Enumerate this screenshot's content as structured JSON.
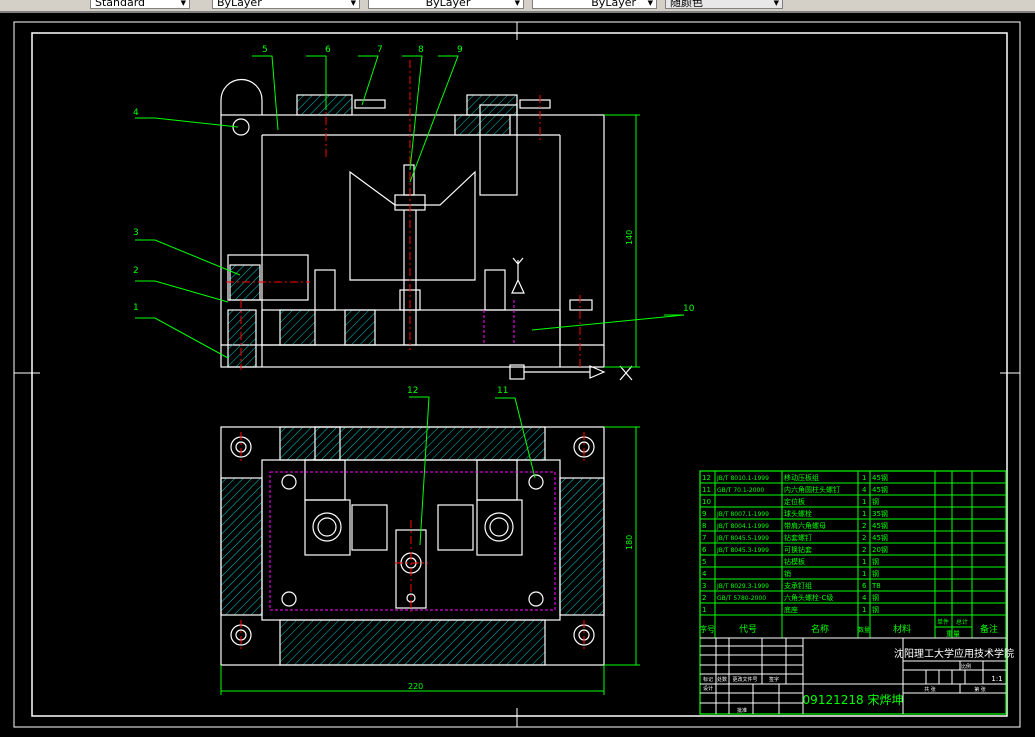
{
  "toolbar": {
    "text_style": "Standard",
    "layer": "ByLayer",
    "linetype": "ByLayer",
    "lineweight": "ByLayer",
    "color": "随颜色"
  },
  "colors": {
    "background": "#000000",
    "lines": "#ffffff",
    "annotation": "#00ff00",
    "centerline": "#ff0000",
    "hatch": "#00ffff"
  },
  "drawing": {
    "balloons": [
      "1",
      "2",
      "3",
      "4",
      "5",
      "6",
      "7",
      "8",
      "9",
      "10",
      "11",
      "12"
    ],
    "dimensions": {
      "height_front": "140",
      "height_top": "180",
      "width_top": "220"
    },
    "axis_labels": {
      "x": "X",
      "y": "Y"
    }
  },
  "parts_list": {
    "headers": {
      "no": "序号",
      "code": "代号",
      "name": "名称",
      "qty": "数量",
      "material": "材料",
      "unit": "单件",
      "total": "总计",
      "weight": "重量",
      "remark": "备注"
    },
    "rows": [
      {
        "no": "12",
        "code": "JB/T 8010.1-1999",
        "name": "移动压板组",
        "qty": "1",
        "material": "45钢"
      },
      {
        "no": "11",
        "code": "GB/T 70.1-2000",
        "name": "内六角圆柱头螺钉",
        "qty": "4",
        "material": "45钢"
      },
      {
        "no": "10",
        "code": "",
        "name": "定位板",
        "qty": "1",
        "material": "钢"
      },
      {
        "no": "9",
        "code": "JB/T 8007.1-1999",
        "name": "球头螺栓",
        "qty": "1",
        "material": "35钢"
      },
      {
        "no": "8",
        "code": "JB/T 8004.1-1999",
        "name": "带肩六角螺母",
        "qty": "2",
        "material": "45钢"
      },
      {
        "no": "7",
        "code": "JB/T 8045.5-1999",
        "name": "钻套螺钉",
        "qty": "2",
        "material": "45钢"
      },
      {
        "no": "6",
        "code": "JB/T 8045.3-1999",
        "name": "可换钻套",
        "qty": "2",
        "material": "20钢"
      },
      {
        "no": "5",
        "code": "",
        "name": "钻模板",
        "qty": "1",
        "material": "钢"
      },
      {
        "no": "4",
        "code": "",
        "name": "销",
        "qty": "1",
        "material": "钢"
      },
      {
        "no": "3",
        "code": "JB/T 8029.3-1999",
        "name": "支承钉组",
        "qty": "6",
        "material": "T8"
      },
      {
        "no": "2",
        "code": "GB/T 5780-2000",
        "name": "六角头螺栓-C级",
        "qty": "4",
        "material": "钢"
      },
      {
        "no": "1",
        "code": "",
        "name": "底座",
        "qty": "1",
        "material": "钢"
      }
    ]
  },
  "title_block": {
    "school": "沈阳理工大学应用技术学院",
    "student": "09121218 宋烨坤",
    "scale": "1:1",
    "labels": {
      "mark": "标记",
      "count": "处数",
      "doc": "更改文件号",
      "sign": "签字",
      "design": "设计",
      "approve": "批准",
      "review": "审核",
      "sheet": "共 张",
      "sheet2": "第 张",
      "ratio": "比例"
    }
  }
}
